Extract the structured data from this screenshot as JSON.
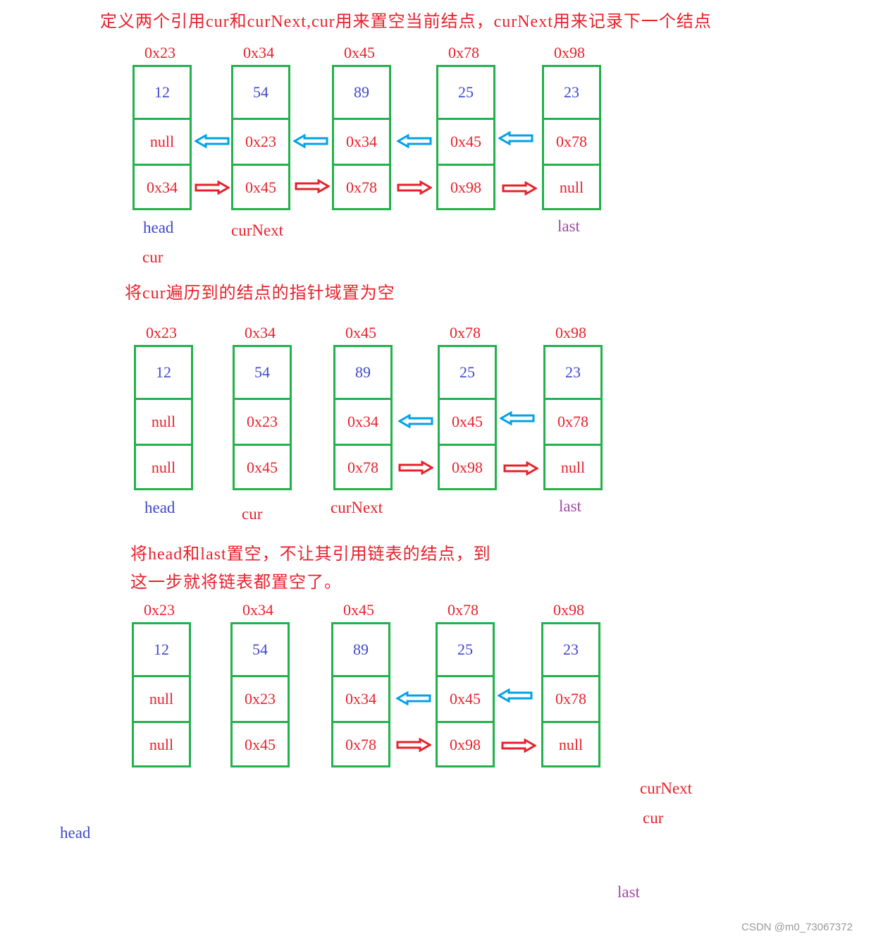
{
  "captions": {
    "step1": "定义两个引用cur和curNext,cur用来置空当前结点，curNext用来记录下一个结点",
    "step2": "将cur遍历到的结点的指针域置为空",
    "step3_line1": "将head和last置空，不让其引用链表的结点，到",
    "step3_line2": "这一步就将链表都置空了。"
  },
  "diagrams": [
    {
      "nodes": [
        {
          "address": "0x23",
          "value": "12",
          "prev": "null",
          "next": "0x34"
        },
        {
          "address": "0x34",
          "value": "54",
          "prev": "0x23",
          "next": "0x45"
        },
        {
          "address": "0x45",
          "value": "89",
          "prev": "0x34",
          "next": "0x78"
        },
        {
          "address": "0x78",
          "value": "25",
          "prev": "0x45",
          "next": "0x98"
        },
        {
          "address": "0x98",
          "value": "23",
          "prev": "0x78",
          "next": "null"
        }
      ],
      "labels": {
        "head": "head",
        "cur": "cur",
        "curNext": "curNext",
        "last": "last"
      }
    },
    {
      "nodes": [
        {
          "address": "0x23",
          "value": "12",
          "prev": "null",
          "next": "null"
        },
        {
          "address": "0x34",
          "value": "54",
          "prev": "0x23",
          "next": "0x45"
        },
        {
          "address": "0x45",
          "value": "89",
          "prev": "0x34",
          "next": "0x78"
        },
        {
          "address": "0x78",
          "value": "25",
          "prev": "0x45",
          "next": "0x98"
        },
        {
          "address": "0x98",
          "value": "23",
          "prev": "0x78",
          "next": "null"
        }
      ],
      "labels": {
        "head": "head",
        "cur": "cur",
        "curNext": "curNext",
        "last": "last"
      }
    },
    {
      "nodes": [
        {
          "address": "0x23",
          "value": "12",
          "prev": "null",
          "next": "null"
        },
        {
          "address": "0x34",
          "value": "54",
          "prev": "0x23",
          "next": "0x45"
        },
        {
          "address": "0x45",
          "value": "89",
          "prev": "0x34",
          "next": "0x78"
        },
        {
          "address": "0x78",
          "value": "25",
          "prev": "0x45",
          "next": "0x98"
        },
        {
          "address": "0x98",
          "value": "23",
          "prev": "0x78",
          "next": "null"
        }
      ],
      "labels": {
        "head": "head",
        "cur": "cur",
        "curNext": "curNext",
        "last": "last"
      }
    }
  ],
  "colors": {
    "border": "#22b14c",
    "prev_arrow": "#00a2e8",
    "next_arrow": "#e8212b"
  },
  "watermark": "CSDN @m0_73067372"
}
